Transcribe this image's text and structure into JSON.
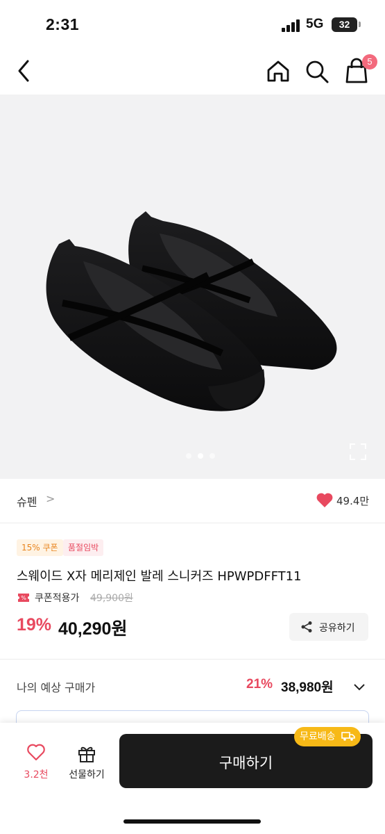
{
  "status_bar": {
    "time": "2:31",
    "network": "5G",
    "battery": "32"
  },
  "header": {
    "cart_badge": "5",
    "icons": [
      "chevron-left-icon",
      "home-icon",
      "search-icon",
      "shopping-bag-icon"
    ]
  },
  "gallery": {
    "dot_count": 3,
    "active_dot": 1
  },
  "brand": {
    "name": "슈펜",
    "chevron": ">",
    "likes": "49.4만"
  },
  "tags": {
    "coupon": "15% 쿠폰",
    "soon_sold_out": "품절임박"
  },
  "product": {
    "title": "스웨이드 X자 메리제인 발레 스니커즈 HPWPDFFT11",
    "coupon_applied_label": "쿠폰적용가",
    "original_price": "49,900원",
    "discount_rate": "19%",
    "sale_price": "40,290원",
    "share_label": "공유하기"
  },
  "expected": {
    "label": "나의 예상 구매가",
    "rate": "21%",
    "price": "38,980원"
  },
  "bottom_bar": {
    "wish_count": "3.2천",
    "gift_label": "선물하기",
    "buy_label": "구매하기",
    "free_shipping": "무료배송"
  },
  "colors": {
    "accent": "#e8495f",
    "coupon_orange": "#e8841d",
    "free_ship_yellow": "#f7b917",
    "buy_button": "#1b1b1b"
  }
}
